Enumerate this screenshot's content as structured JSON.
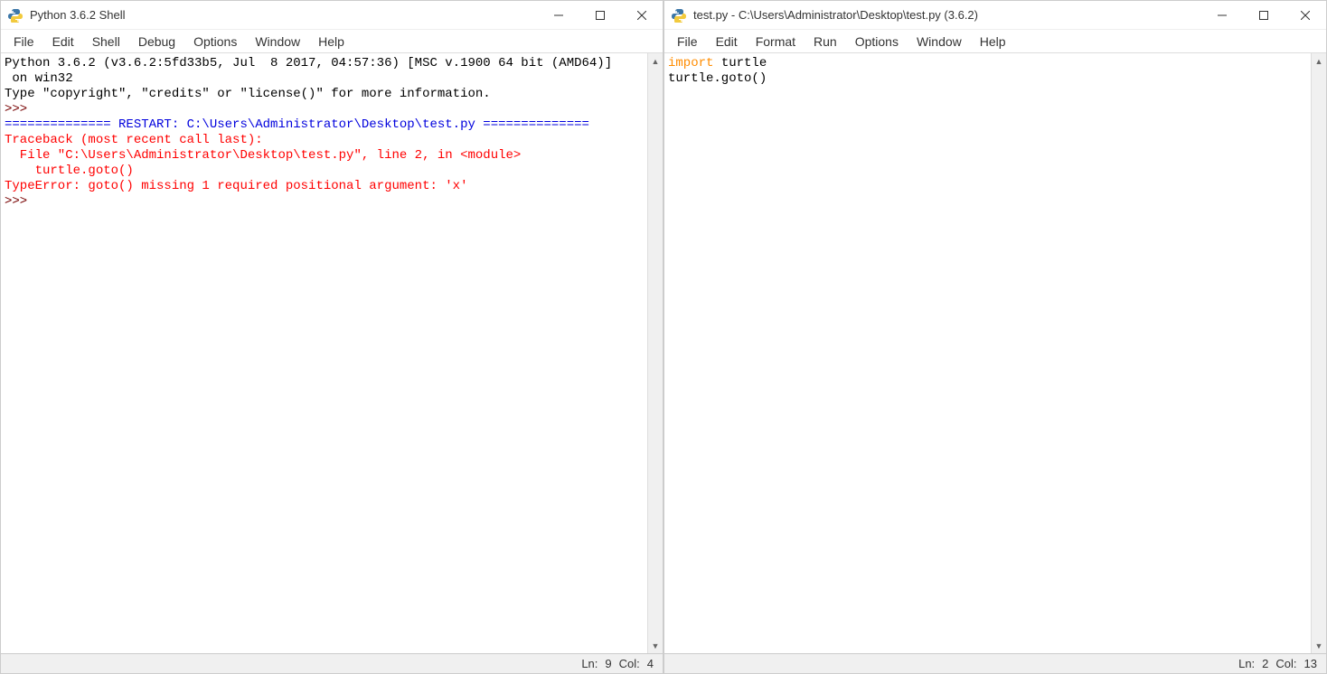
{
  "shell": {
    "title": "Python 3.6.2 Shell",
    "menu": {
      "file": "File",
      "edit": "Edit",
      "shell": "Shell",
      "debug": "Debug",
      "options": "Options",
      "window": "Window",
      "help": "Help"
    },
    "lines": {
      "l1": "Python 3.6.2 (v3.6.2:5fd33b5, Jul  8 2017, 04:57:36) [MSC v.1900 64 bit (AMD64)]",
      "l2": " on win32",
      "l3": "Type \"copyright\", \"credits\" or \"license()\" for more information.",
      "l4_prompt": ">>> ",
      "l5": "============== RESTART: C:\\Users\\Administrator\\Desktop\\test.py ==============",
      "l6": "Traceback (most recent call last):",
      "l7": "  File \"C:\\Users\\Administrator\\Desktop\\test.py\", line 2, in <module>",
      "l8": "    turtle.goto()",
      "l9": "TypeError: goto() missing 1 required positional argument: 'x'",
      "l10_prompt": ">>> "
    },
    "status": {
      "ln_label": "Ln:",
      "ln_value": "9",
      "col_label": "Col:",
      "col_value": "4"
    }
  },
  "editor": {
    "title": "test.py - C:\\Users\\Administrator\\Desktop\\test.py (3.6.2)",
    "menu": {
      "file": "File",
      "edit": "Edit",
      "format": "Format",
      "run": "Run",
      "options": "Options",
      "window": "Window",
      "help": "Help"
    },
    "code": {
      "l1_kw": "import",
      "l1_rest": " turtle",
      "l2": "turtle.goto()"
    },
    "status": {
      "ln_label": "Ln:",
      "ln_value": "2",
      "col_label": "Col:",
      "col_value": "13"
    }
  }
}
